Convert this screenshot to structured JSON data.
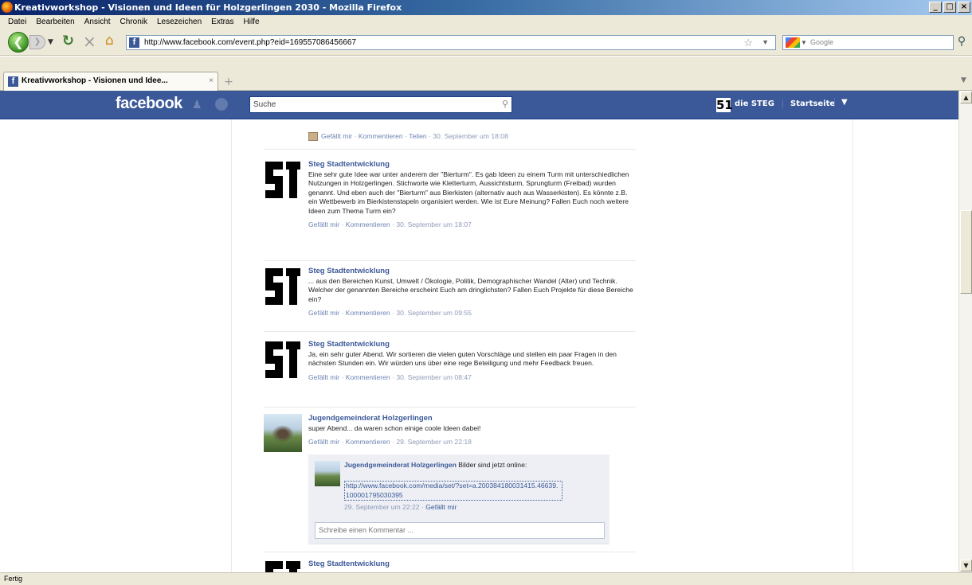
{
  "window": {
    "title": "Kreativworkshop - Visionen und Ideen für Holzgerlingen 2030 - Mozilla Firefox",
    "controls": [
      "_",
      "□",
      "×"
    ]
  },
  "menu": [
    "Datei",
    "Bearbeiten",
    "Ansicht",
    "Chronik",
    "Lesezeichen",
    "Extras",
    "Hilfe"
  ],
  "toolbar": {
    "url": "http://www.facebook.com/event.php?eid=169557086456667",
    "search_placeholder": "Google"
  },
  "tab": {
    "label": "Kreativworkshop - Visionen und Idee...",
    "close": "×",
    "new_tab": "+"
  },
  "facebook": {
    "logo": "facebook",
    "search_placeholder": "Suche",
    "profile_name": "die STEG",
    "home": "Startseite",
    "account_arrow": "▼"
  },
  "top_meta": {
    "like": "Gefällt mir",
    "comment": "Kommentieren",
    "share": "Teilen",
    "time": "30. September um 18:08"
  },
  "posts": [
    {
      "author": "Steg Stadtentwicklung",
      "text": "Eine sehr gute Idee war unter anderem der \"Bierturm\". Es gab Ideen zu einem Turm mit unterschiedlichen Nutzungen in Holzgerlingen. Stichworte wie Kletterturm, Aussichtsturm, Sprungturm (Freibad) wurden genannt. Und eben auch der \"Bierturm\" aus Bierkisten (alternativ auch aus Wasserkisten). Es könnte z.B. ein Wettbewerb im Bierkistenstapeln organisiert werden. Wie ist Eure Meinung? Fallen Euch noch weitere Ideen zum Thema Turm ein?",
      "like": "Gefällt mir",
      "comment": "Kommentieren",
      "time": "30. September um 18:07"
    },
    {
      "author": "Steg Stadtentwicklung",
      "text": "... aus den Bereichen Kunst, Umwelt / Ökologie, Politik, Demographischer Wandel (Alter) und Technik. Welcher der genannten Bereiche erscheint Euch am dringlichsten? Fallen Euch Projekte für diese Bereiche ein?",
      "like": "Gefällt mir",
      "comment": "Kommentieren",
      "time": "30. September um 09:55"
    },
    {
      "author": "Steg Stadtentwicklung",
      "text": "Ja, ein sehr guter Abend. Wir sortieren die vielen guten Vorschläge und stellen ein paar Fragen in den nächsten Stunden ein. Wir würden uns über eine rege Beteiligung und mehr Feedback freuen.",
      "like": "Gefällt mir",
      "comment": "Kommentieren",
      "time": "30. September um 08:47"
    },
    {
      "author": "Jugendgemeinderat Holzgerlingen",
      "text": "super Abend... da waren schon einige coole Ideen dabei!",
      "like": "Gefällt mir",
      "comment": "Kommentieren",
      "time": "29. September um 22:18"
    },
    {
      "author": "Steg Stadtentwicklung"
    }
  ],
  "comment": {
    "author": "Jugendgemeinderat Holzgerlingen",
    "text": " Bilder sind jetzt online:",
    "link": "http://www.facebook.com/media/set/?set=a.200384180031415.46639.100001795030395",
    "time": "29. September um 22:22",
    "like": "Gefällt mir",
    "input_placeholder": "Schreibe einen Kommentar ..."
  },
  "status": "Fertig"
}
